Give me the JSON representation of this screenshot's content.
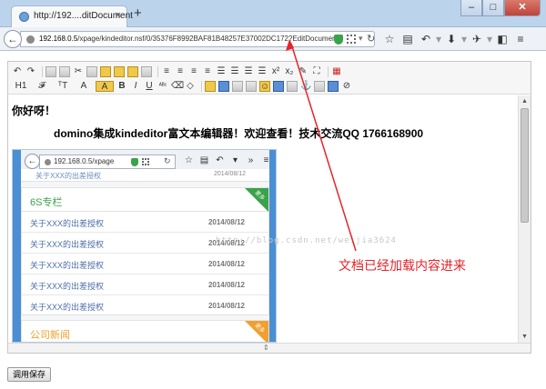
{
  "browser": {
    "tab_title": "http://192....ditDocument",
    "tab_close": "×",
    "new_tab": "+",
    "window_buttons": {
      "minimize": "–",
      "maximize": "□",
      "close": "✕"
    },
    "back": "←",
    "url_host": "192.168.0.5",
    "url_path": "/xpage/kindeditor.nsf/0/35376F8992BAF81B48257E37002DC172?EditDocument",
    "nav_icons": [
      "☆",
      "▤",
      "↶",
      "▾",
      "⬇",
      "▾",
      "✈",
      "▾",
      "◧",
      "≡"
    ]
  },
  "editor": {
    "greeting": "你好呀！",
    "headline": "domino集成kindeditor富文本编辑器！欢迎查看！技术交流QQ 1766168900",
    "toolbar_row1": [
      "↶",
      "↷",
      "▥",
      "▨",
      "✂",
      "▤",
      "▤",
      "▤",
      "▤",
      "▤",
      "≡",
      "≡",
      "≡",
      "≡",
      "☰",
      "☰",
      "x²",
      "x₂",
      "✎",
      "⛶",
      "▦"
    ],
    "toolbar_row2": [
      "H1",
      "𝓕",
      "ᵀT",
      "A",
      "A",
      "B",
      "I",
      "U",
      "ᴬᴮᶜ",
      "⌫",
      "◇",
      "▭",
      "▣",
      "▦",
      "☺",
      "▤",
      "▦",
      "⚓",
      "⎘",
      "∞",
      "⊘"
    ],
    "resize_glyph": "⇕"
  },
  "embedded": {
    "url": "192.168.0.5/xpage",
    "top_cut_item": {
      "title": "关于XXX的出差授权",
      "date": "2014/08/12"
    },
    "section1": {
      "name": "6S专栏",
      "corner": "更多",
      "color": "#3aa34a",
      "rows": [
        {
          "title": "关于XXX的出差授权",
          "date": "2014/08/12"
        },
        {
          "title": "关于XXX的出差授权",
          "date": "2014/08/12"
        },
        {
          "title": "关于XXX的出差授权",
          "date": "2014/08/12"
        },
        {
          "title": "关于XXX的出差授权",
          "date": "2014/08/12"
        },
        {
          "title": "关于XXX的出差授权",
          "date": "2014/08/12"
        }
      ]
    },
    "section2": {
      "name": "公司新闻",
      "corner": "更多",
      "color": "#f0a030"
    },
    "watermark": "http://blog.csdn.net/weijia3624"
  },
  "annotation": {
    "text": "文档已经加载内容进来",
    "color": "#e8232a"
  },
  "actions": {
    "call_save": "调用保存"
  }
}
